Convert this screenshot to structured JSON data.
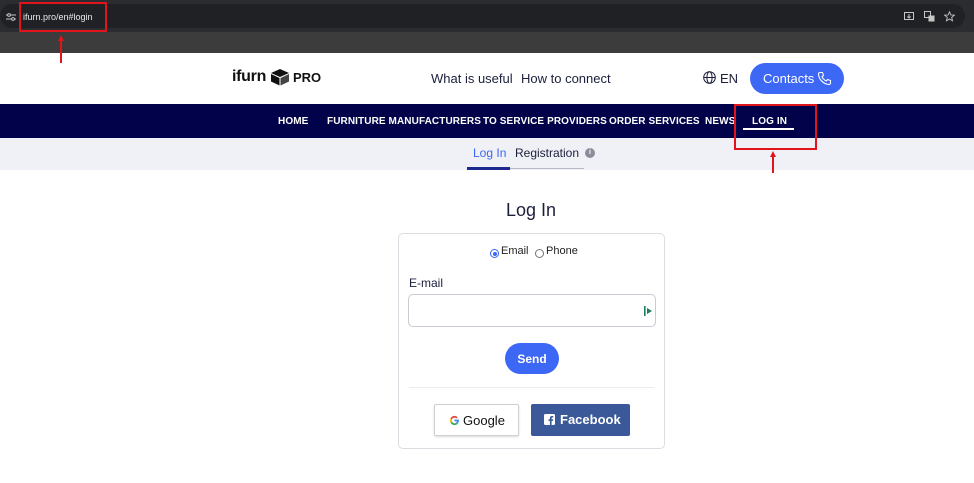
{
  "browser": {
    "url": "ifurn.pro/en#login"
  },
  "header": {
    "logo_text": "ifurn",
    "logo_suffix": "PRO",
    "links": [
      "What is useful",
      "How to connect"
    ],
    "language": "EN",
    "contacts_label": "Contacts"
  },
  "nav": {
    "items": [
      "HOME",
      "FURNITURE MANUFACTURERS",
      "TO SERVICE PROVIDERS",
      "ORDER SERVICES",
      "NEWS",
      "LOG IN"
    ],
    "active": "LOG IN"
  },
  "tabs": {
    "login": "Log In",
    "registration": "Registration",
    "info_glyph": "i"
  },
  "form": {
    "title": "Log In",
    "method_email": "Email",
    "method_phone": "Phone",
    "selected_method": "Email",
    "email_label": "E-mail",
    "email_value": "",
    "email_placeholder": "",
    "send_label": "Send",
    "google_label": "Google",
    "facebook_label": "Facebook"
  },
  "colors": {
    "accent": "#3d67f5",
    "nav_background": "#02024a",
    "facebook": "#3b5998",
    "annotation": "#e0151b"
  }
}
